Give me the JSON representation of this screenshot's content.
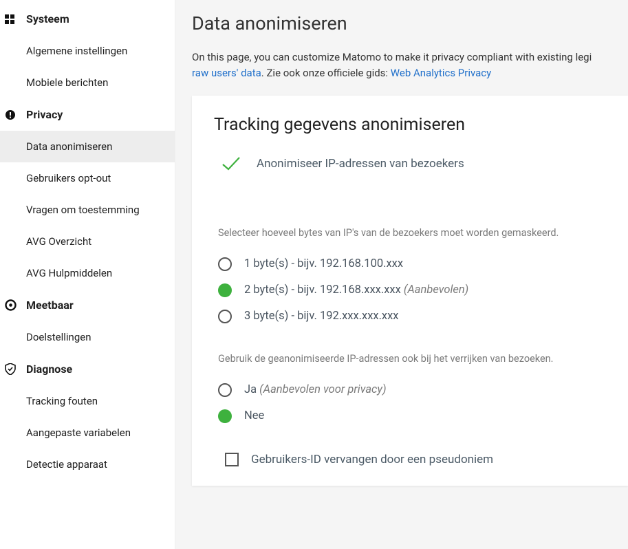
{
  "sidebar": {
    "sections": [
      {
        "label": "Systeem",
        "icon": "system",
        "items": [
          {
            "label": "Algemene instellingen",
            "active": false
          },
          {
            "label": "Mobiele berichten",
            "active": false
          }
        ]
      },
      {
        "label": "Privacy",
        "icon": "privacy",
        "items": [
          {
            "label": "Data anonimiseren",
            "active": true
          },
          {
            "label": "Gebruikers opt-out",
            "active": false
          },
          {
            "label": "Vragen om toestemming",
            "active": false
          },
          {
            "label": "AVG Overzicht",
            "active": false
          },
          {
            "label": "AVG Hulpmiddelen",
            "active": false
          }
        ]
      },
      {
        "label": "Meetbaar",
        "icon": "measurable",
        "items": [
          {
            "label": "Doelstellingen",
            "active": false
          }
        ]
      },
      {
        "label": "Diagnose",
        "icon": "diagnose",
        "items": [
          {
            "label": "Tracking fouten",
            "active": false
          },
          {
            "label": "Aangepaste variabelen",
            "active": false
          },
          {
            "label": "Detectie apparaat",
            "active": false
          }
        ]
      }
    ]
  },
  "page": {
    "title": "Data anonimiseren",
    "desc_pre": "On this page, you can customize Matomo to make it privacy compliant with existing legi",
    "desc_link1": "raw users' data",
    "desc_mid": ". Zie ook onze officiele gids: ",
    "desc_link2": "Web Analytics Privacy"
  },
  "card": {
    "title": "Tracking gegevens anonimiseren",
    "ip_anon_label": "Anonimiseer IP-adressen van bezoekers",
    "bytes_label": "Selecteer hoeveel bytes van IP's van de bezoekers moet worden gemaskeerd.",
    "bytes_options": [
      {
        "text": "1 byte(s) - bijv. 192.168.100.xxx",
        "hint": "",
        "selected": false
      },
      {
        "text": "2 byte(s) - bijv. 192.168.xxx.xxx ",
        "hint": "(Aanbevolen)",
        "selected": true
      },
      {
        "text": "3 byte(s) - bijv. 192.xxx.xxx.xxx",
        "hint": "",
        "selected": false
      }
    ],
    "enrich_label": "Gebruik de geanonimiseerde IP-adressen ook bij het verrijken van bezoeken.",
    "enrich_options": [
      {
        "text": "Ja ",
        "hint": "(Aanbevolen voor privacy)",
        "selected": false
      },
      {
        "text": "Nee",
        "hint": "",
        "selected": true
      }
    ],
    "userid_label": "Gebruikers-ID vervangen door een pseudoniem"
  }
}
